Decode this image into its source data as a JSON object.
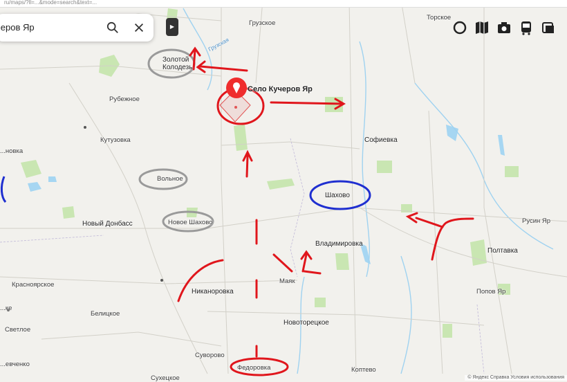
{
  "browser_bar": {
    "text": "ru/maps/?ll=...&mode=search&text=..."
  },
  "search": {
    "value": "черов Яр"
  },
  "place_label": "Село Кучеров Яр",
  "map_labels": {
    "torskoe": "Торское",
    "gruzskoe": "Грузское",
    "gruzskaya": "Грузская",
    "zolotoy_kolodez": "Золотой\nКолодезь",
    "rubezhnoe": "Рубежное",
    "kutuzovka": "Кутузовка",
    "sofievka": "Софиевка",
    "ivanovka": "...новка",
    "volnoe": "Вольное",
    "shahovo": "Шахово",
    "novy_donbass": "Новый Донбасс",
    "novoe_shahovo": "Новое Шахово",
    "vladimirovka": "Владимировка",
    "rusin_yar": "Русин Яр",
    "poltavka": "Полтавка",
    "krasnoyarskoe": "Красноярское",
    "nikanorovka": "Никаноровка",
    "mayak": "Маяк",
    "popov_yar": "Попов Яр",
    "belitskoe": "Белицкое",
    "svetloe": "Светлое",
    "novotoretskoe": "Новоторецкое",
    "kope": "...ке",
    "suvorovo": "Суворово",
    "fedorovka": "Федоровка",
    "koptevo": "Коптево",
    "suhetskoe": "Сухецкое",
    "shevchenko": "...евченко"
  },
  "footer": "© Яндекс  Справка  Условия использования",
  "colors": {
    "annotation_red": "#e0161c",
    "annotation_blue": "#1f2fd0",
    "annotation_gray": "#9a9a9a",
    "green": "#bfe3a6",
    "water": "#9fd2f0"
  }
}
